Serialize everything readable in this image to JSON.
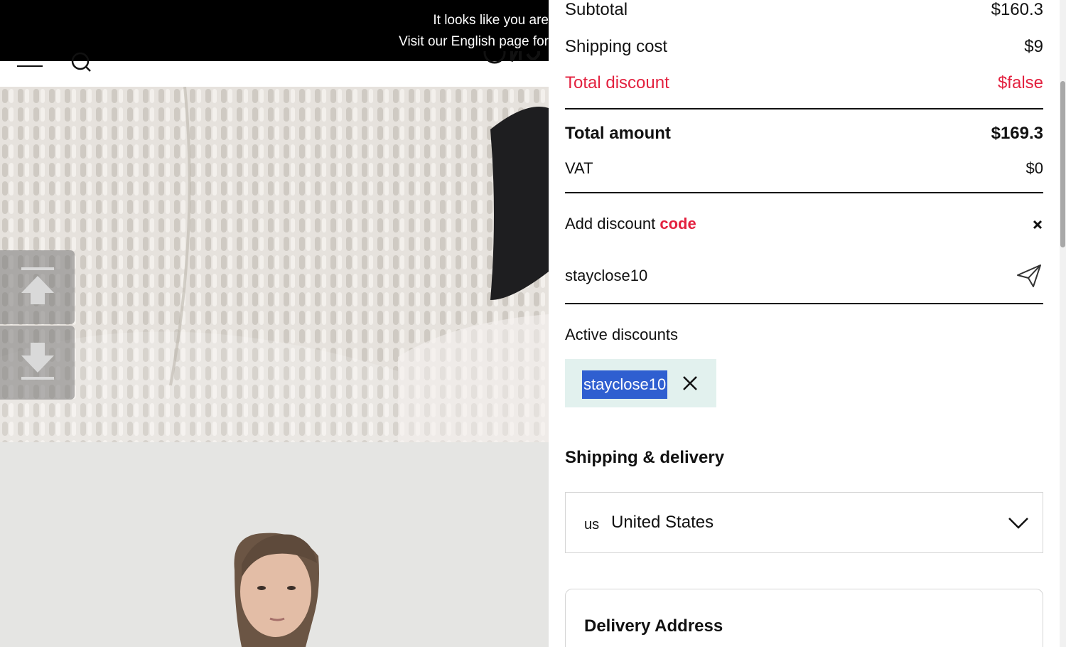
{
  "background_page": {
    "banner": {
      "line1": "It looks like you are",
      "line2": "Visit our English page for"
    },
    "header": {
      "menu_icon": "hamburger-icon",
      "search_icon": "search-icon"
    }
  },
  "summary": {
    "subtotal_label": "Subtotal",
    "subtotal_value": "$160.3",
    "shipping_label": "Shipping cost",
    "shipping_value": "$9",
    "discount_label": "Total discount",
    "discount_value": "$false",
    "total_label": "Total amount",
    "total_value": "$169.3",
    "vat_label": "VAT",
    "vat_value": "$0"
  },
  "discount": {
    "title_prefix": "Add discount",
    "title_emphasis": "code",
    "input_value": "stayclose10",
    "active_label": "Active discounts",
    "active_codes": [
      "stayclose10"
    ]
  },
  "shipping": {
    "heading": "Shipping & delivery",
    "country_code": "us",
    "country_name": "United States"
  },
  "address": {
    "heading": "Delivery Address"
  },
  "icons": {
    "close": "close-icon",
    "send": "paper-plane-icon",
    "remove": "x-icon",
    "chevron": "chevron-down-icon",
    "scroll_up": "arrow-up-icon",
    "scroll_down": "arrow-down-icon"
  },
  "colors": {
    "discount_red": "#e3213f",
    "chip_bg": "#e2f1ee",
    "selection_blue": "#2f5fd0"
  }
}
